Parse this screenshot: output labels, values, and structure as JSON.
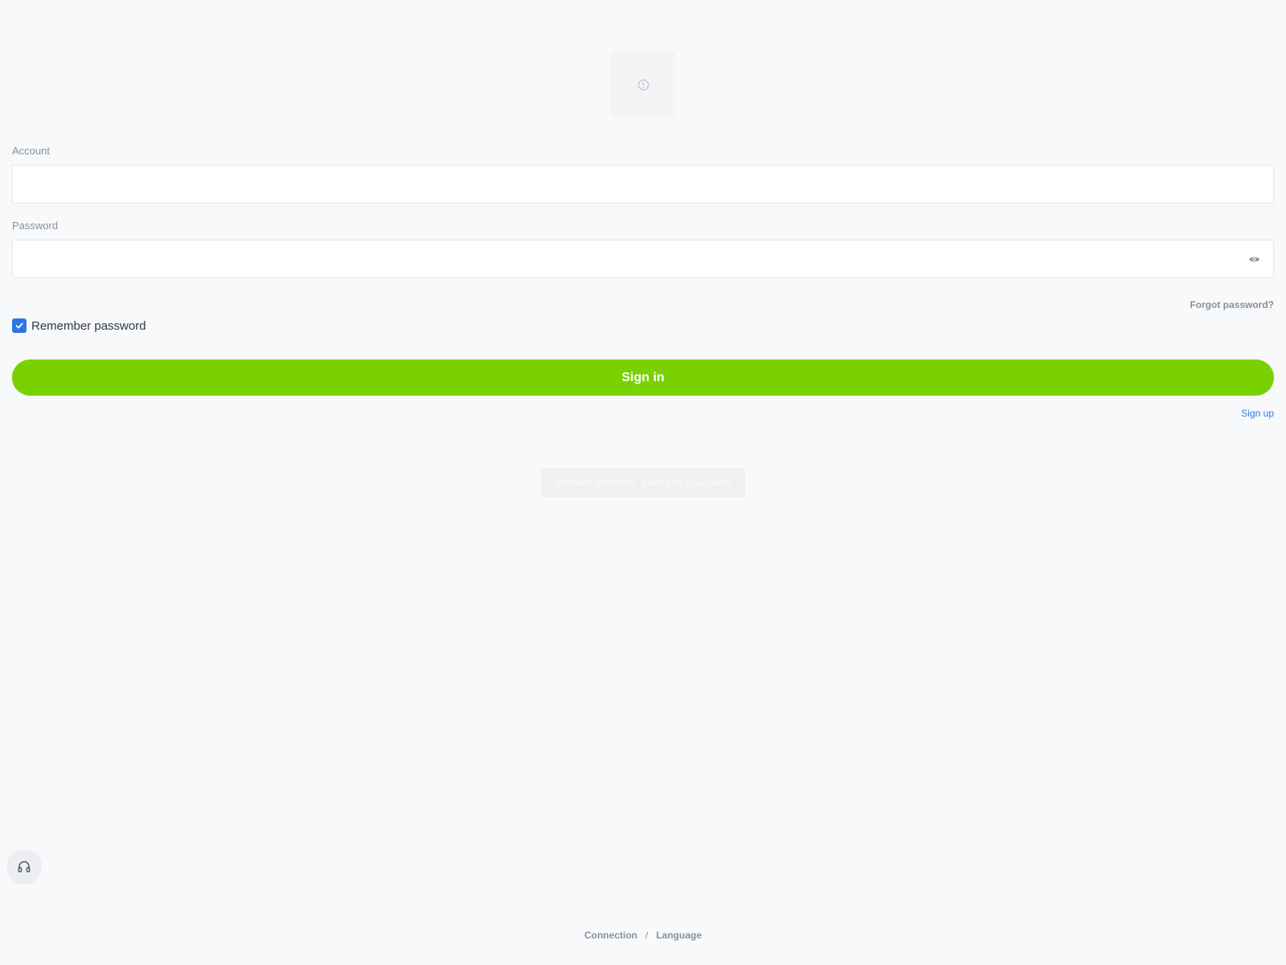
{
  "logo": {
    "icon": "broken-image-icon"
  },
  "form": {
    "account_label": "Account",
    "account_value": "",
    "password_label": "Password",
    "password_value": "",
    "password_toggle_icon": "eye-icon",
    "forgot_password": "Forgot password?",
    "remember_label": "Remember password",
    "remember_checked": true,
    "signin_label": "Sign in",
    "signup_label": "Sign up"
  },
  "toast": {
    "message": "Interface exception, please try again later"
  },
  "support": {
    "icon": "headset-icon"
  },
  "footer": {
    "connection": "Connection",
    "separator": "/",
    "language": "Language"
  },
  "colors": {
    "background": "#f7f9fb",
    "primary_button": "#79d200",
    "checkbox": "#2f74e6",
    "link": "#2f74e6",
    "muted_text": "#8a9099"
  }
}
